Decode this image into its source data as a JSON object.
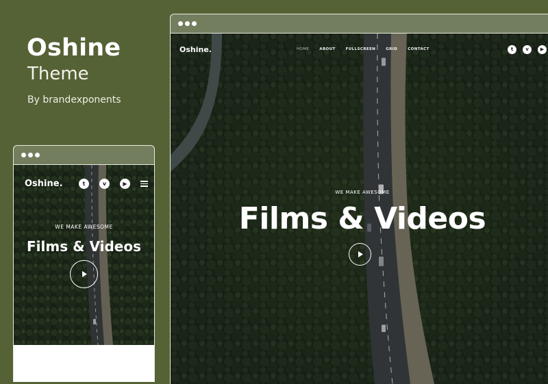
{
  "promo": {
    "title": "Oshine",
    "subtitle": "Theme",
    "byline": "By brandexponents"
  },
  "site": {
    "logo": "Oshine.",
    "nav": [
      "HOME",
      "ABOUT",
      "FULLSCREEN",
      "GRID",
      "CONTACT"
    ],
    "active_nav": "HOME",
    "social": [
      "twitter-icon",
      "vimeo-icon",
      "youtube-icon"
    ],
    "social_glyphs": [
      "t",
      "v",
      "▶"
    ],
    "tagline": "WE MAKE AWESOME",
    "headline": "Films & Videos"
  },
  "colors": {
    "background": "#556236",
    "window_titlebar": "#737e5e",
    "forest": "#1f2a1a",
    "road": "#3a3f41"
  }
}
